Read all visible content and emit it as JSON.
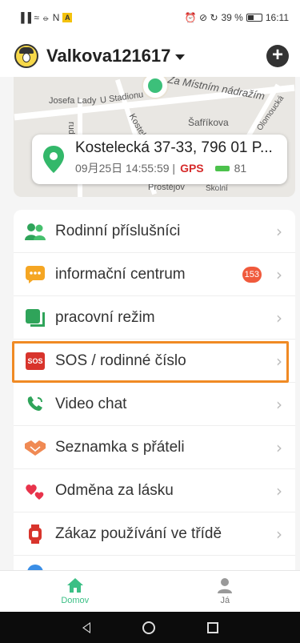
{
  "statusbar": {
    "left": "▐▐ ≈ ⦵ N",
    "warn": "A",
    "right_icons": "⏰ ⊘ ↻",
    "battery_pct": "39 %",
    "time": "16:11"
  },
  "header": {
    "title": "Valkova121617",
    "add_icon": "plus-icon"
  },
  "map": {
    "labels": {
      "street1": "Za Místním nádražím",
      "street2": "Josefa Lady",
      "street3": "U Stadionu",
      "street4": "rudova",
      "street5": "Kostelecká",
      "street6": "Šafříkova",
      "street7": "Olomoucká",
      "street8": "Prostějov",
      "street9": "Školní"
    },
    "location": {
      "address": "Kostelecká 37-33, 796 01 P...",
      "datetime": "09月25日 14:55:59 |",
      "source": "GPS",
      "battery": "81"
    }
  },
  "menu": {
    "items": [
      {
        "label": "Rodinní příslušníci",
        "icon": "family-icon"
      },
      {
        "label": "informační centrum",
        "icon": "message-icon",
        "badge": "153"
      },
      {
        "label": "pracovní režim",
        "icon": "mode-icon"
      },
      {
        "label": "SOS / rodinné číslo",
        "icon": "sos-icon",
        "icon_text": "SOS"
      },
      {
        "label": "Video chat",
        "icon": "phone-icon"
      },
      {
        "label": "Seznamka s přáteli",
        "icon": "handshake-icon"
      },
      {
        "label": "Odměna za lásku",
        "icon": "hearts-icon"
      },
      {
        "label": "Zákaz používání ve třídě",
        "icon": "watch-icon"
      }
    ]
  },
  "bottomnav": {
    "home": "Domov",
    "me": "Já"
  },
  "colors": {
    "accent": "#3bbf85",
    "highlight": "#f08a24",
    "gps": "#d62b2b"
  }
}
